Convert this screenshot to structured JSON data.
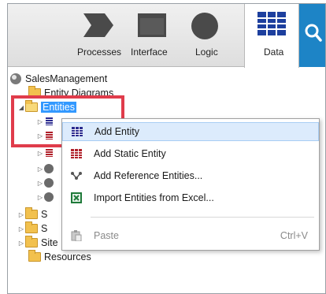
{
  "toolbar": {
    "tabs": [
      {
        "label": "Processes",
        "icon": "processes-icon"
      },
      {
        "label": "Interface",
        "icon": "interface-icon"
      },
      {
        "label": "Logic",
        "icon": "logic-icon"
      },
      {
        "label": "Data",
        "icon": "data-icon",
        "selected": true
      }
    ],
    "search_icon": "search-icon"
  },
  "tree": {
    "root": "SalesManagement",
    "entity_diagrams": "Entity Diagrams",
    "entities": "Entities",
    "s1": "S",
    "s2": "S",
    "site_properties": "Site Properties",
    "resources": "Resources"
  },
  "context_menu": {
    "items": [
      {
        "label": "Add Entity",
        "icon": "entity-icon"
      },
      {
        "label": "Add Static Entity",
        "icon": "static-entity-icon"
      },
      {
        "label": "Add Reference Entities...",
        "icon": "reference-icon"
      },
      {
        "label": "Import Entities from Excel...",
        "icon": "excel-icon"
      },
      {
        "label": "Paste",
        "icon": "paste-icon",
        "shortcut": "Ctrl+V",
        "disabled": true
      }
    ]
  },
  "colors": {
    "accent": "#1d84c6",
    "highlight": "#e03c4b",
    "selection": "#3399ff",
    "hover": "#dcebfc"
  }
}
